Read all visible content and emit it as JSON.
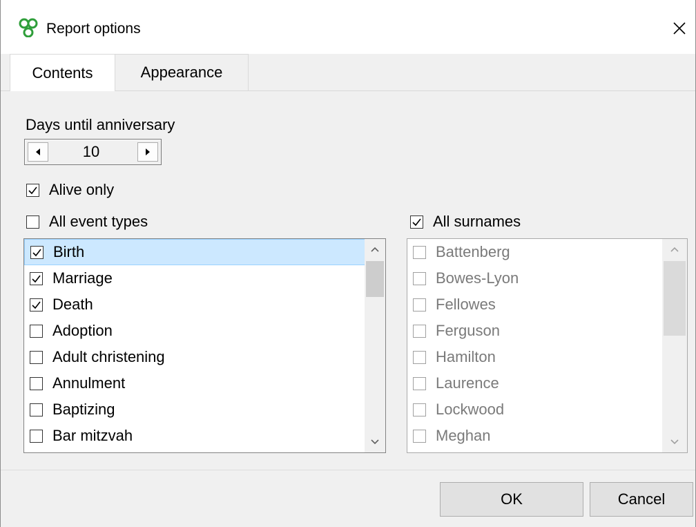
{
  "window": {
    "title": "Report options",
    "app_icon": "family-tree-icon",
    "close_glyph": "✕"
  },
  "tabs": [
    {
      "label": "Contents",
      "active": true
    },
    {
      "label": "Appearance",
      "active": false
    }
  ],
  "days": {
    "label": "Days until anniversary",
    "value": "10"
  },
  "alive_only": {
    "label": "Alive only",
    "checked": true
  },
  "all_event_types": {
    "label": "All event types",
    "checked": false
  },
  "all_surnames": {
    "label": "All surnames",
    "checked": true
  },
  "event_types": [
    {
      "label": "Birth",
      "checked": true,
      "selected": true
    },
    {
      "label": "Marriage",
      "checked": true
    },
    {
      "label": "Death",
      "checked": true
    },
    {
      "label": "Adoption",
      "checked": false
    },
    {
      "label": "Adult christening",
      "checked": false
    },
    {
      "label": "Annulment",
      "checked": false
    },
    {
      "label": "Baptizing",
      "checked": false
    },
    {
      "label": "Bar mitzvah",
      "checked": false
    }
  ],
  "surnames": [
    {
      "label": "Battenberg",
      "checked": false
    },
    {
      "label": "Bowes-Lyon",
      "checked": false
    },
    {
      "label": "Fellowes",
      "checked": false
    },
    {
      "label": "Ferguson",
      "checked": false
    },
    {
      "label": "Hamilton",
      "checked": false
    },
    {
      "label": "Laurence",
      "checked": false
    },
    {
      "label": "Lockwood",
      "checked": false
    },
    {
      "label": "Meghan",
      "checked": false
    }
  ],
  "buttons": {
    "ok": "OK",
    "cancel": "Cancel"
  },
  "colors": {
    "selection": "#cce8ff",
    "app_icon_green": "#3cb043",
    "disabled_text": "#7a7a7a"
  }
}
